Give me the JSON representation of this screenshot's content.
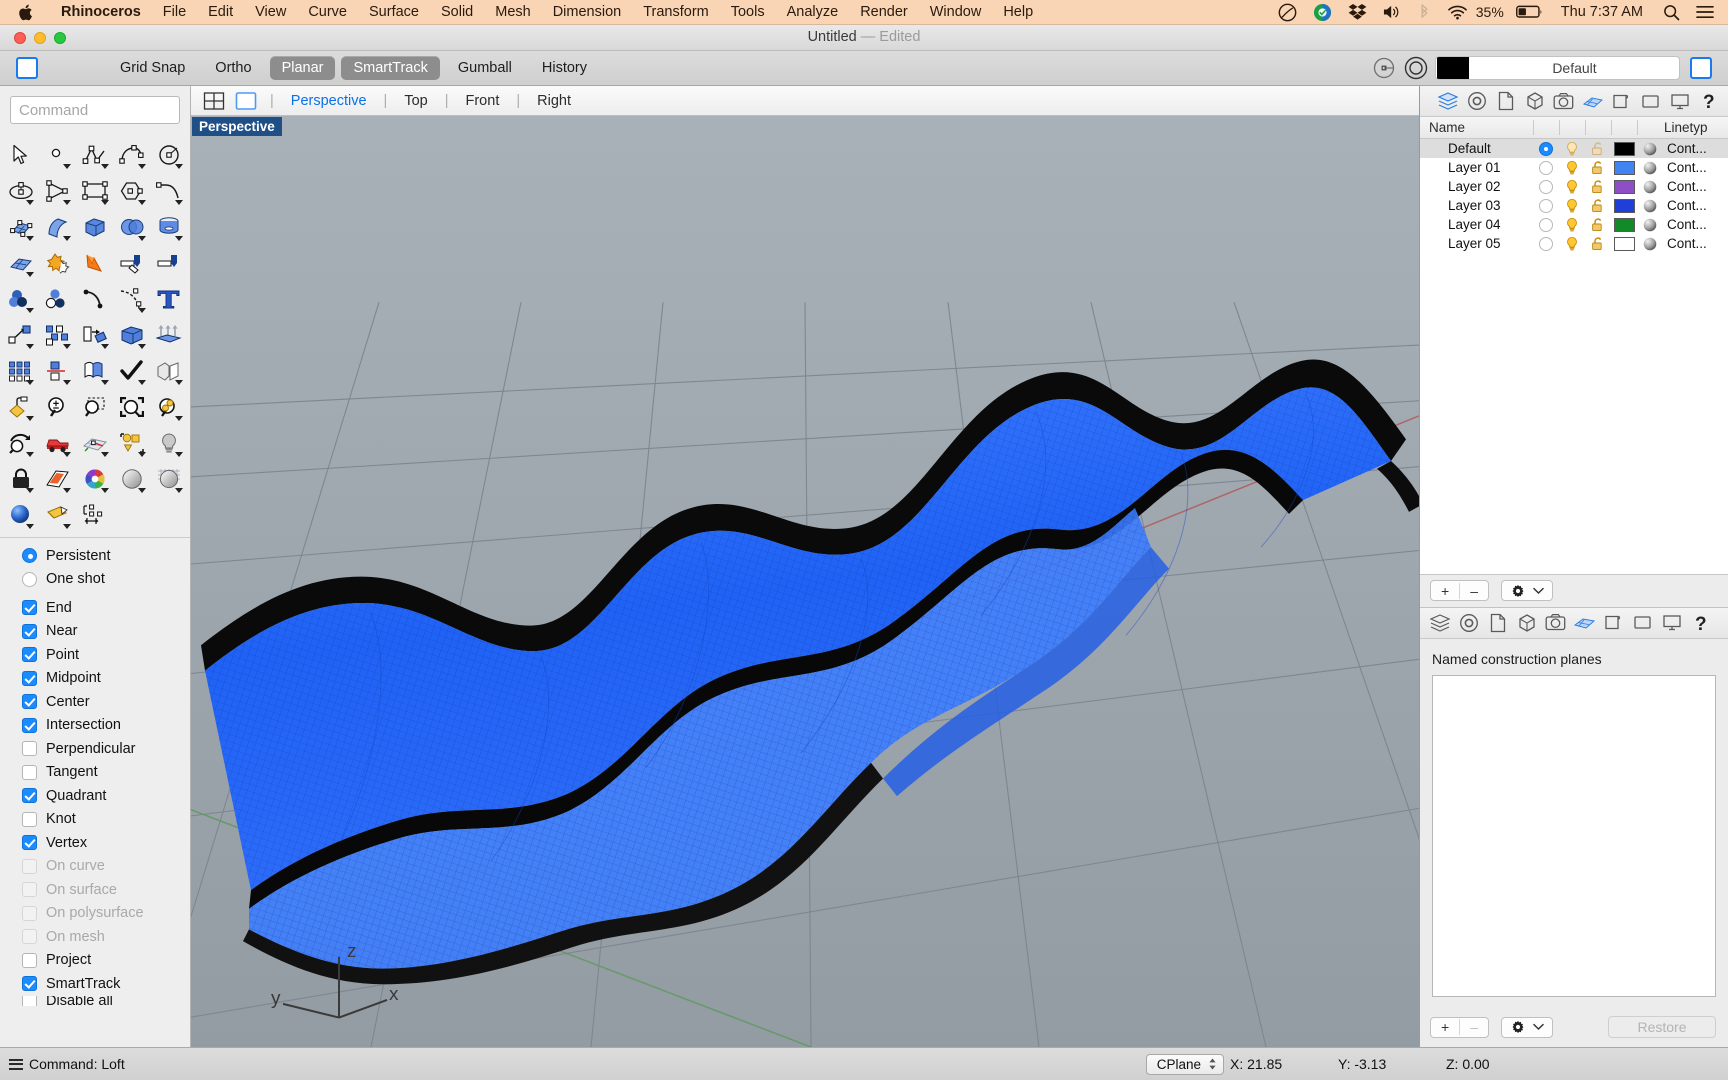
{
  "menubar": {
    "apple_glyph": "",
    "items": [
      "Rhinoceros",
      "File",
      "Edit",
      "View",
      "Curve",
      "Surface",
      "Solid",
      "Mesh",
      "Dimension",
      "Transform",
      "Tools",
      "Analyze",
      "Render",
      "Window",
      "Help"
    ],
    "status_icons": [
      "rhino-icon",
      "grasshopper-icon",
      "dropbox-icon",
      "volume-icon",
      "bluetooth-icon",
      "wifi-icon"
    ],
    "battery_percent": "35%",
    "clock": "Thu 7:37 AM",
    "search_icon": "spotlight-search-icon",
    "control_center_icon": "control-center-icon",
    "bg_color": "#f9d5b5"
  },
  "window": {
    "title": "Untitled",
    "dash": "—",
    "state": "Edited"
  },
  "options_toolbar": {
    "toggles": [
      {
        "label": "Grid Snap",
        "active": false
      },
      {
        "label": "Ortho",
        "active": false
      },
      {
        "label": "Planar",
        "active": true
      },
      {
        "label": "SmartTrack",
        "active": true
      },
      {
        "label": "Gumball",
        "active": false
      },
      {
        "label": "History",
        "active": false
      }
    ],
    "layer_swatch_color": "#000000",
    "layer_name": "Default",
    "left_panel_toggle": "left-sidebar-toggle",
    "right_panel_toggle": "right-sidebar-toggle"
  },
  "command": {
    "placeholder": "Command"
  },
  "tool_palette": {
    "rows": [
      [
        "select-arrow",
        "point",
        "polyline",
        "curve-control-points",
        "circle"
      ],
      [
        "ellipse",
        "arc",
        "rectangle",
        "polygon",
        "curve-fillet"
      ],
      [
        "surface-from-points",
        "extrude-surface",
        "box-solid",
        "sphere-boolean",
        "cylinder-pipe"
      ],
      [
        "surface-grid",
        "boolean-union",
        "explode-burst",
        "offset-surface",
        "offset-surface-2"
      ],
      [
        "object-intersect",
        "boolean-difference",
        "curve-tools",
        "curve-from-object",
        "text-tool"
      ],
      [
        "move-object",
        "array-objects",
        "rotate-object",
        "scale-3d",
        "extrude-up"
      ],
      [
        "array-grid",
        "mirror-object",
        "flow-along-surface",
        "check-object",
        "split-object"
      ],
      [
        "paint-bucket",
        "zoom-in-out",
        "zoom-window",
        "zoom-extents",
        "zoom-selected"
      ],
      [
        "rotate-view",
        "named-view",
        "cplane-grid",
        "select-objects",
        "light-bulb"
      ],
      [
        "lock-object",
        "render-shade",
        "color-wheel",
        "render-sphere",
        "mesh-sphere"
      ],
      [
        "render-preview",
        "clipping-plane",
        "dimension-tools"
      ]
    ]
  },
  "osnap": {
    "mode_options": [
      {
        "label": "Persistent",
        "selected": true
      },
      {
        "label": "One shot",
        "selected": false
      }
    ],
    "snaps": [
      {
        "label": "End",
        "checked": true,
        "disabled": false
      },
      {
        "label": "Near",
        "checked": true,
        "disabled": false
      },
      {
        "label": "Point",
        "checked": true,
        "disabled": false
      },
      {
        "label": "Midpoint",
        "checked": true,
        "disabled": false
      },
      {
        "label": "Center",
        "checked": true,
        "disabled": false
      },
      {
        "label": "Intersection",
        "checked": true,
        "disabled": false
      },
      {
        "label": "Perpendicular",
        "checked": false,
        "disabled": false
      },
      {
        "label": "Tangent",
        "checked": false,
        "disabled": false
      },
      {
        "label": "Quadrant",
        "checked": true,
        "disabled": false
      },
      {
        "label": "Knot",
        "checked": false,
        "disabled": false
      },
      {
        "label": "Vertex",
        "checked": true,
        "disabled": false
      },
      {
        "label": "On curve",
        "checked": false,
        "disabled": true
      },
      {
        "label": "On surface",
        "checked": false,
        "disabled": true
      },
      {
        "label": "On polysurface",
        "checked": false,
        "disabled": true
      },
      {
        "label": "On mesh",
        "checked": false,
        "disabled": true
      },
      {
        "label": "Project",
        "checked": false,
        "disabled": false
      },
      {
        "label": "SmartTrack",
        "checked": true,
        "disabled": false
      },
      {
        "label": "Disable all",
        "checked": false,
        "disabled": false
      }
    ]
  },
  "viewport": {
    "tabs": [
      {
        "label": "Perspective",
        "active": true
      },
      {
        "label": "Top",
        "active": false
      },
      {
        "label": "Front",
        "active": false
      },
      {
        "label": "Right",
        "active": false
      }
    ],
    "layout_icons": [
      "four-view-layout-icon",
      "single-view-layout-icon"
    ],
    "label": "Perspective",
    "axis_labels": {
      "x": "x",
      "y": "y",
      "z": "z"
    },
    "background_color": "#9aa3ab",
    "object_color": "#2b6cff",
    "object_edge_color": "#000000"
  },
  "right_panel": {
    "tab_icons": [
      "layers-icon",
      "properties-icon",
      "page-icon",
      "object-icon",
      "camera-icon",
      "help-icon"
    ],
    "columns": {
      "name": "Name",
      "linetype": "Linetyp"
    },
    "layers": [
      {
        "name": "Default",
        "current": true,
        "visible": true,
        "locked": false,
        "color": "#000000",
        "linetype": "Cont...",
        "selected": true
      },
      {
        "name": "Layer 01",
        "current": false,
        "visible": true,
        "locked": false,
        "color": "#3f84f2",
        "linetype": "Cont...",
        "selected": false
      },
      {
        "name": "Layer 02",
        "current": false,
        "visible": true,
        "locked": false,
        "color": "#8e4ec6",
        "linetype": "Cont...",
        "selected": false
      },
      {
        "name": "Layer 03",
        "current": false,
        "visible": true,
        "locked": false,
        "color": "#1f3fd8",
        "linetype": "Cont...",
        "selected": false
      },
      {
        "name": "Layer 04",
        "current": false,
        "visible": true,
        "locked": false,
        "color": "#128a2a",
        "linetype": "Cont...",
        "selected": false
      },
      {
        "name": "Layer 05",
        "current": false,
        "visible": true,
        "locked": false,
        "color": "#ffffff",
        "linetype": "Cont...",
        "selected": false
      }
    ],
    "layer_buttons": {
      "add": "+",
      "remove": "–",
      "gear": "gear-icon",
      "chevron": "chevron-down-icon"
    }
  },
  "lower_right_panel": {
    "tab_icons": [
      "layers-icon",
      "properties-icon",
      "page-icon",
      "object-icon",
      "camera-icon",
      "cplane-icon",
      "display-icon",
      "view-icon",
      "monitor-icon",
      "help-icon"
    ],
    "title": "Named construction planes",
    "buttons": {
      "add": "+",
      "remove": "–",
      "gear": "gear-icon",
      "chevron": "chevron-down-icon",
      "restore": "Restore"
    }
  },
  "status_bar": {
    "menu_icon": "hamburger-icon",
    "command_text": "Command: Loft",
    "cplane_label": "CPlane",
    "coords": {
      "x": "X: 21.85",
      "y": "Y: -3.13",
      "z": "Z: 0.00"
    }
  }
}
